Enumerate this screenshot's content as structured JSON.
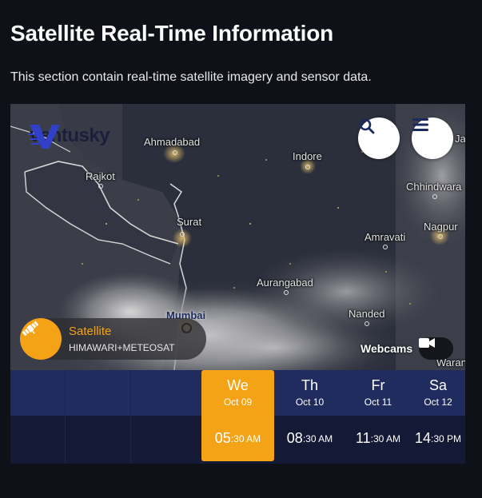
{
  "page": {
    "title": "Satellite Real-Time Information",
    "subtitle": "This section contain real-time satellite imagery and sensor data."
  },
  "map": {
    "logo_text": "ventusky",
    "cities": [
      "Ahmadabad",
      "Rajkot",
      "Indore",
      "Chhindwara",
      "Jal",
      "Surat",
      "Nagpur",
      "Amravati",
      "Aurangabad",
      "Nanded",
      "Mumbai",
      "Waran"
    ],
    "search_icon": "search-icon",
    "menu_icon": "hamburger-menu-icon",
    "layer": {
      "title": "Satellite",
      "source": "HIMAWARI+METEOSAT",
      "icon": "satellite-icon"
    },
    "webcams": {
      "label": "Webcams",
      "icon": "video-camera-icon"
    }
  },
  "timeline": {
    "days": [
      {
        "name": "We",
        "date": "Oct 09",
        "active": true
      },
      {
        "name": "Th",
        "date": "Oct 10",
        "active": false
      },
      {
        "name": "Fr",
        "date": "Oct 11",
        "active": false
      },
      {
        "name": "Sa",
        "date": "Oct 12",
        "active": false
      }
    ],
    "times": [
      {
        "hour": "05",
        "minute": ":30 AM",
        "active": true
      },
      {
        "hour": "08",
        "minute": ":30 AM",
        "active": false
      },
      {
        "hour": "11",
        "minute": ":30 AM",
        "active": false
      },
      {
        "hour": "14",
        "minute": ":30 PM",
        "active": false
      }
    ]
  },
  "colors": {
    "accent": "#f5a316",
    "page_background": "#0e1117",
    "timeline_days_bg": "#212c5e",
    "timeline_times_bg": "#141a36"
  }
}
